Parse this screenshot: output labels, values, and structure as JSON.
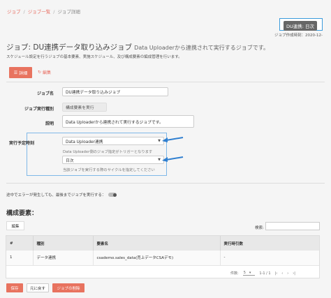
{
  "breadcrumb": {
    "home": "ジョブ",
    "list": "ジョブ一覧",
    "current": "ジョブ詳細"
  },
  "badge": "DU連携: 日次",
  "created": "ジョブ作成時刻：2020-12-",
  "title": {
    "main": "ジョブ: DU連携データ取り込みジョブ",
    "sub": "Data Uploaderから連携されて実行するジョブです。"
  },
  "description": "スケジュール設定を行うジョブの基本要素、実施スケジュール、及び構成要素の編成管理を行います。",
  "actions": {
    "detail": "詳細",
    "edit": "編集"
  },
  "form": {
    "job_name_label": "ジョブ名",
    "job_name_value": "DU連携データ取り込みジョブ",
    "type_label": "ジョブ実行種別",
    "type_value": "構成要素を実行",
    "desc_label": "説明",
    "desc_value": "Data Uploaderから連携されて実行するジョブです。",
    "schedule_label": "実行予定時刻",
    "schedule_trigger": "Data Uploader連携",
    "schedule_trigger_hint": "Data Uploader側のジョブ指定がトリガーとなります",
    "schedule_cycle": "日次",
    "schedule_cycle_hint": "当該ジョブを実行する際のサイクルを指定してください"
  },
  "toggle_label": "途中でエラーが発生しても、最後までジョブを実行する：",
  "components": {
    "title": "構成要素：",
    "edit_button": "編集",
    "search_label": "検索:",
    "headers": [
      "#",
      "種別",
      "要素名",
      "実行時引数"
    ],
    "rows": [
      [
        "1",
        "データ連携",
        "csademo.sales_data(売上データCSAデモ)",
        "-"
      ]
    ],
    "pager": {
      "label": "件数:",
      "per_page": "5",
      "range": "1-1 / 1"
    }
  },
  "footer": {
    "save": "保存",
    "back": "元に戻す",
    "delete": "ジョブの削除"
  },
  "colors": {
    "accent": "#e8735f",
    "highlight": "#3a9bdc"
  }
}
